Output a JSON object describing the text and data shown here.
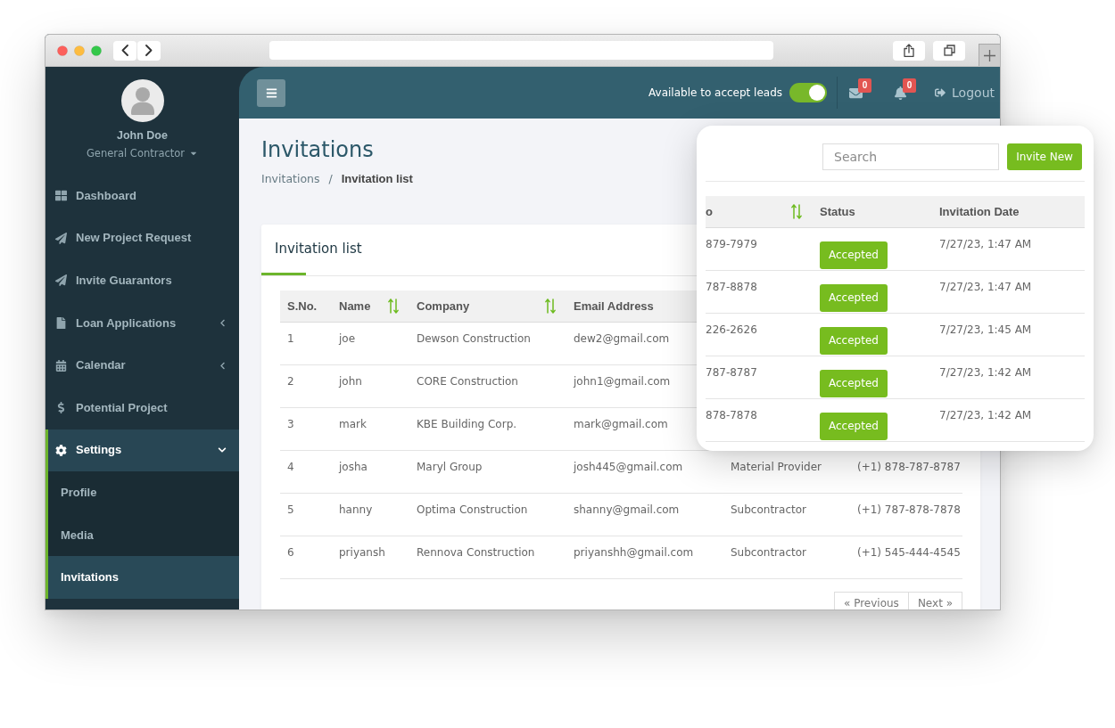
{
  "sidebar": {
    "user": {
      "name": "John Doe",
      "role": "General Contractor"
    },
    "items": [
      {
        "label": "Dashboard",
        "kind": "link",
        "selected": false
      },
      {
        "label": "New Project Request",
        "kind": "link",
        "selected": false
      },
      {
        "label": "Invite Guarantors",
        "kind": "link",
        "selected": false
      },
      {
        "label": "Loan Applications",
        "kind": "group",
        "expanded": false,
        "selected": false
      },
      {
        "label": "Calendar",
        "kind": "group",
        "expanded": false,
        "selected": false
      },
      {
        "label": "Potential Project",
        "kind": "link",
        "selected": false
      },
      {
        "label": "Settings",
        "kind": "group",
        "expanded": true,
        "selected": true,
        "children": [
          {
            "label": "Profile",
            "selected": false
          },
          {
            "label": "Media",
            "selected": false
          },
          {
            "label": "Invitations",
            "selected": true
          }
        ]
      }
    ]
  },
  "header": {
    "availability": {
      "label": "Available to accept leads",
      "on": true
    },
    "messages": {
      "count": "0"
    },
    "notifications": {
      "count": "0"
    },
    "logout": "Logout"
  },
  "page": {
    "title": "Invitations",
    "breadcrumb": {
      "separator": "/",
      "items": [
        {
          "label": "Invitations",
          "current": false
        },
        {
          "label": "Invitation list",
          "current": true
        }
      ]
    }
  },
  "invitation_list": {
    "title": "Invitation list",
    "columns": [
      {
        "label": "S.No.",
        "sortable": false
      },
      {
        "label": "Name",
        "sortable": true
      },
      {
        "label": "Company",
        "sortable": true
      },
      {
        "label": "Email Address",
        "sortable": false
      }
    ],
    "rows": [
      {
        "cells": [
          "1",
          "joe",
          "Dewson Construction",
          "dew2@gmail.com"
        ]
      },
      {
        "cells": [
          "2",
          "john",
          "CORE Construction",
          "john1@gmail.com"
        ]
      },
      {
        "cells": [
          "3",
          "mark",
          "KBE Building Corp.",
          "mark@gmail.com"
        ]
      },
      {
        "cells": [
          "4",
          "josha",
          "Maryl Group",
          "josh445@gmail.com",
          "Material Provider",
          "(+1) 878-787-8787"
        ]
      },
      {
        "cells": [
          "5",
          "hanny",
          "Optima Construction",
          "shanny@gmail.com",
          "Subcontractor",
          "(+1) 787-878-7878"
        ]
      },
      {
        "cells": [
          "6",
          "priyansh",
          "Rennova Construction",
          "priyanshh@gmail.com",
          "Subcontractor",
          "(+1) 545-444-4545"
        ]
      }
    ],
    "pagination": {
      "previous": "« Previous",
      "next": "Next »"
    }
  },
  "overlay_card": {
    "search": {
      "placeholder": "Search"
    },
    "invite_button": "Invite New",
    "columns": [
      {
        "label": "o",
        "sortable": true
      },
      {
        "label": "Status",
        "sortable": false
      },
      {
        "label": "Invitation Date",
        "sortable": false
      }
    ],
    "rows": [
      {
        "column_1": "879-7979",
        "status": "Accepted",
        "invitation_date": "7/27/23, 1:47 AM"
      },
      {
        "column_1": "787-8878",
        "status": "Accepted",
        "invitation_date": "7/27/23, 1:47 AM"
      },
      {
        "column_1": "226-2626",
        "status": "Accepted",
        "invitation_date": "7/27/23, 1:45 AM"
      },
      {
        "column_1": "787-8787",
        "status": "Accepted",
        "invitation_date": "7/27/23, 1:42 AM"
      },
      {
        "column_1": "878-7878",
        "status": "Accepted",
        "invitation_date": "7/27/23, 1:42 AM"
      }
    ]
  }
}
